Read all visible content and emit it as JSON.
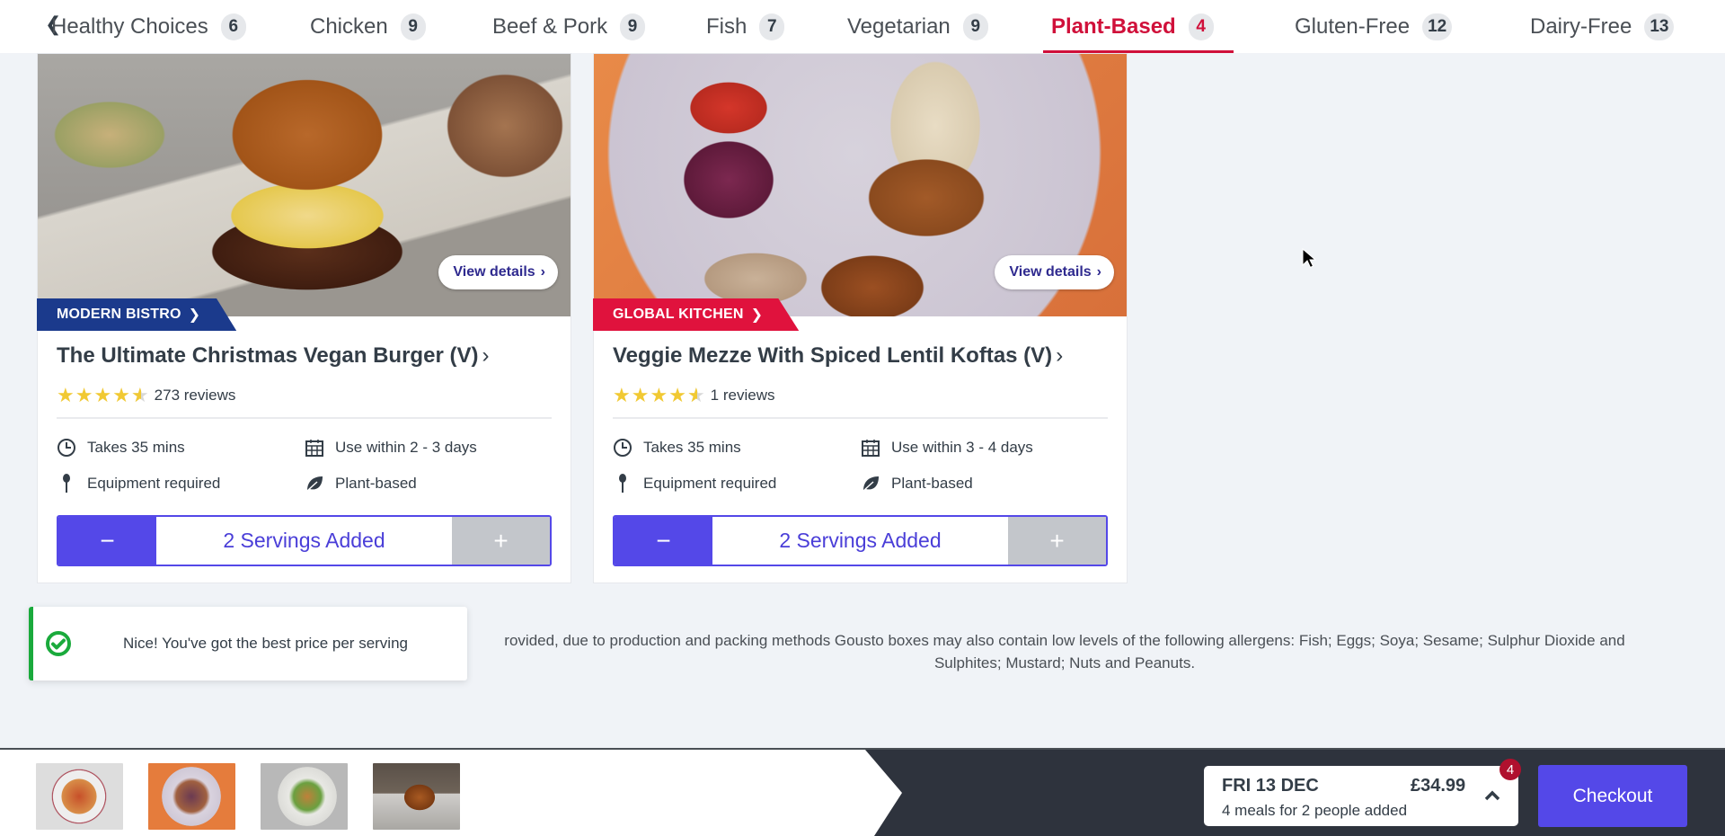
{
  "nav": {
    "back_icon": "chevron-left-icon",
    "tabs": [
      {
        "label": "Healthy Choices",
        "count": "6",
        "active": false
      },
      {
        "label": "Chicken",
        "count": "9",
        "active": false
      },
      {
        "label": "Beef & Pork",
        "count": "9",
        "active": false
      },
      {
        "label": "Fish",
        "count": "7",
        "active": false
      },
      {
        "label": "Vegetarian",
        "count": "9",
        "active": false
      },
      {
        "label": "Plant-Based",
        "count": "4",
        "active": true
      },
      {
        "label": "Gluten-Free",
        "count": "12",
        "active": false
      },
      {
        "label": "Dairy-Free",
        "count": "13",
        "active": false
      }
    ],
    "active_color": "#d0103a"
  },
  "recipes": [
    {
      "kitchen": "MODERN BISTRO",
      "kitchen_color": "#1b3a8c",
      "view_details": "View details",
      "title": "The Ultimate Christmas Vegan Burger (V)",
      "rating": 4.5,
      "reviews": "273 reviews",
      "time": "Takes 35 mins",
      "use_within": "Use within 2 - 3 days",
      "equipment": "Equipment required",
      "diet": "Plant-based",
      "minus": "−",
      "servings": "2 Servings Added",
      "plus": "+"
    },
    {
      "kitchen": "GLOBAL KITCHEN",
      "kitchen_color": "#e0123d",
      "view_details": "View details",
      "title": "Veggie Mezze With Spiced Lentil Koftas (V)",
      "rating": 4.5,
      "reviews": "1 reviews",
      "time": "Takes 35 mins",
      "use_within": "Use within 3 - 4 days",
      "equipment": "Equipment required",
      "diet": "Plant-based",
      "minus": "−",
      "servings": "2 Servings Added",
      "plus": "+"
    }
  ],
  "toast": {
    "message": "Nice! You've got the best price per serving",
    "icon": "check-circle-icon",
    "color": "#1aaa3c"
  },
  "allergen_note": {
    "line1": "rovided, due to production and packing methods Gousto boxes may also contain low levels of the following allergens: Fish; Eggs; Soya; Sesame; Sulphur Dioxide and",
    "line2": "Sulphites; Mustard; Nuts and Peanuts."
  },
  "basket": {
    "thumbnails": [
      "tomato-pasta-thumbnail",
      "veggie-mezze-thumbnail",
      "noodle-bowl-thumbnail",
      "vegan-burger-thumbnail"
    ],
    "date": "FRI 13 DEC",
    "price": "£34.99",
    "summary": "4 meals for 2 people added",
    "count": "4",
    "checkout": "Checkout",
    "accent": "#5448e8"
  }
}
